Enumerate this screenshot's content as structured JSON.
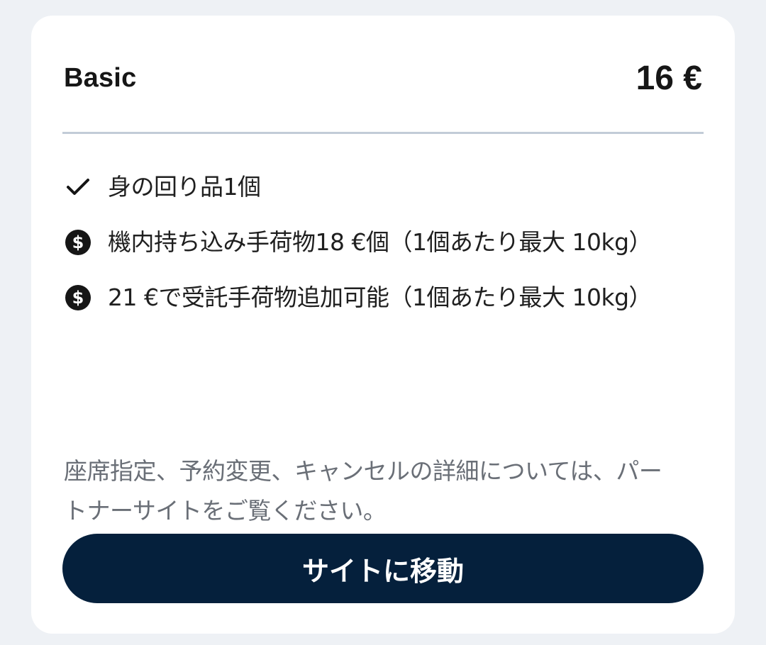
{
  "fare": {
    "name": "Basic",
    "price": "16 €"
  },
  "features": [
    {
      "icon": "check-icon",
      "text": "身の回り品1個"
    },
    {
      "icon": "dollar-coin-icon",
      "text": "機内持ち込み手荷物18 €個（1個あたり最大 10kg）"
    },
    {
      "icon": "dollar-coin-icon",
      "text": "21 €で受託手荷物追加可能（1個あたり最大 10kg）"
    }
  ],
  "note": "座席指定、予約変更、キャンセルの詳細については、パートナーサイトをご覧ください。",
  "cta": {
    "label": "サイトに移動"
  },
  "colors": {
    "page_bg": "#eef1f5",
    "card_bg": "#ffffff",
    "divider": "#c2ccd7",
    "button_bg": "#05203c",
    "text_primary": "#161616",
    "text_secondary": "#6a6f77"
  }
}
